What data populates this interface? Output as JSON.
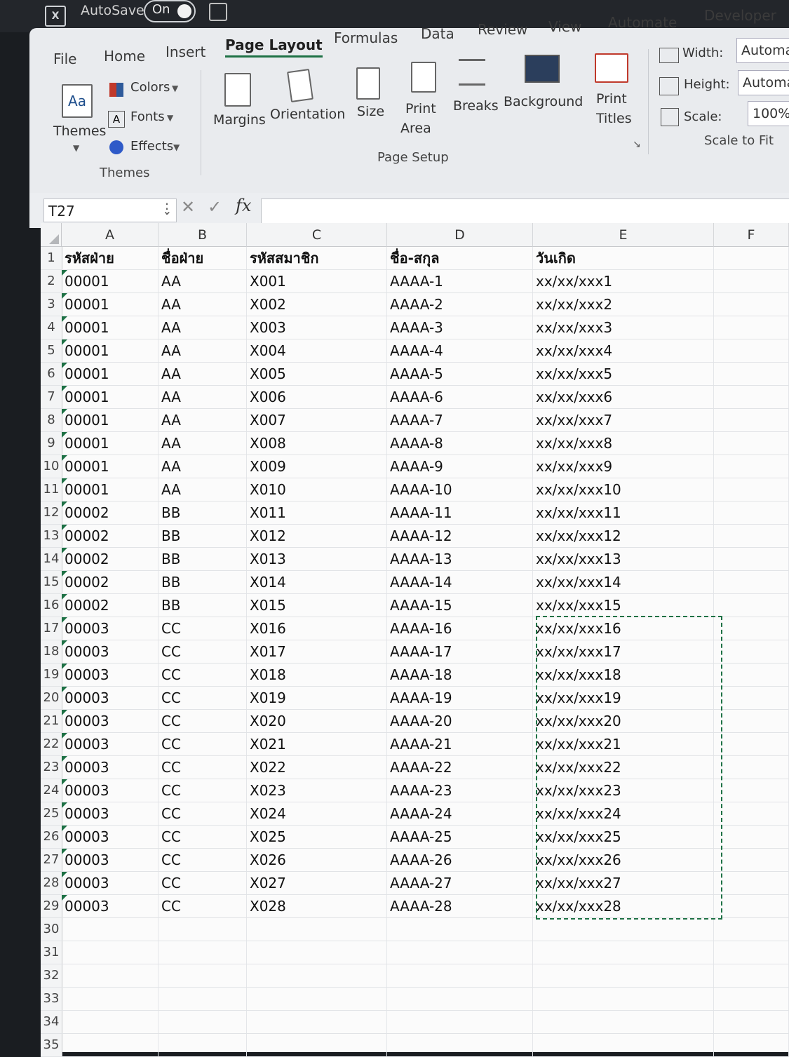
{
  "titlebar": {
    "app_icon": "excel-icon",
    "autosave_label": "AutoSave",
    "autosave_state": "On"
  },
  "ribbon": {
    "tabs": [
      "File",
      "Home",
      "Insert",
      "Page Layout",
      "Formulas",
      "Data",
      "Review",
      "View",
      "Automate",
      "Developer"
    ],
    "active_tab": "Page Layout",
    "themes_group": {
      "themes": "Themes",
      "colors": "Colors",
      "fonts": "Fonts",
      "effects": "Effects",
      "group_name": "Themes"
    },
    "page_setup_group": {
      "margins": "Margins",
      "orientation": "Orientation",
      "size": "Size",
      "print_area_1": "Print",
      "print_area_2": "Area",
      "breaks": "Breaks",
      "background": "Background",
      "print_titles_1": "Print",
      "print_titles_2": "Titles",
      "group_name": "Page Setup"
    },
    "scale_group": {
      "width_label": "Width:",
      "width_value": "Automatic",
      "height_label": "Height:",
      "height_value": "Automatic",
      "scale_label": "Scale:",
      "scale_value": "100%",
      "group_name": "Scale to Fit"
    }
  },
  "formula_bar": {
    "name_box": "T27",
    "cancel_icon": "cancel-icon",
    "enter_icon": "enter-icon",
    "fx_label": "fx",
    "formula": ""
  },
  "sheet": {
    "columns": [
      "A",
      "B",
      "C",
      "D",
      "E",
      "F"
    ],
    "headers": [
      "รหัสฝ่าย",
      "ชื่อฝ่าย",
      "รหัสสมาชิก",
      "ชื่อ-สกุล",
      "วันเกิด"
    ],
    "rows": [
      [
        "00001",
        "AA",
        "X001",
        "AAAA-1",
        "xx/xx/xxx1"
      ],
      [
        "00001",
        "AA",
        "X002",
        "AAAA-2",
        "xx/xx/xxx2"
      ],
      [
        "00001",
        "AA",
        "X003",
        "AAAA-3",
        "xx/xx/xxx3"
      ],
      [
        "00001",
        "AA",
        "X004",
        "AAAA-4",
        "xx/xx/xxx4"
      ],
      [
        "00001",
        "AA",
        "X005",
        "AAAA-5",
        "xx/xx/xxx5"
      ],
      [
        "00001",
        "AA",
        "X006",
        "AAAA-6",
        "xx/xx/xxx6"
      ],
      [
        "00001",
        "AA",
        "X007",
        "AAAA-7",
        "xx/xx/xxx7"
      ],
      [
        "00001",
        "AA",
        "X008",
        "AAAA-8",
        "xx/xx/xxx8"
      ],
      [
        "00001",
        "AA",
        "X009",
        "AAAA-9",
        "xx/xx/xxx9"
      ],
      [
        "00001",
        "AA",
        "X010",
        "AAAA-10",
        "xx/xx/xxx10"
      ],
      [
        "00002",
        "BB",
        "X011",
        "AAAA-11",
        "xx/xx/xxx11"
      ],
      [
        "00002",
        "BB",
        "X012",
        "AAAA-12",
        "xx/xx/xxx12"
      ],
      [
        "00002",
        "BB",
        "X013",
        "AAAA-13",
        "xx/xx/xxx13"
      ],
      [
        "00002",
        "BB",
        "X014",
        "AAAA-14",
        "xx/xx/xxx14"
      ],
      [
        "00002",
        "BB",
        "X015",
        "AAAA-15",
        "xx/xx/xxx15"
      ],
      [
        "00003",
        "CC",
        "X016",
        "AAAA-16",
        "xx/xx/xxx16"
      ],
      [
        "00003",
        "CC",
        "X017",
        "AAAA-17",
        "xx/xx/xxx17"
      ],
      [
        "00003",
        "CC",
        "X018",
        "AAAA-18",
        "xx/xx/xxx18"
      ],
      [
        "00003",
        "CC",
        "X019",
        "AAAA-19",
        "xx/xx/xxx19"
      ],
      [
        "00003",
        "CC",
        "X020",
        "AAAA-20",
        "xx/xx/xxx20"
      ],
      [
        "00003",
        "CC",
        "X021",
        "AAAA-21",
        "xx/xx/xxx21"
      ],
      [
        "00003",
        "CC",
        "X022",
        "AAAA-22",
        "xx/xx/xxx22"
      ],
      [
        "00003",
        "CC",
        "X023",
        "AAAA-23",
        "xx/xx/xxx23"
      ],
      [
        "00003",
        "CC",
        "X024",
        "AAAA-24",
        "xx/xx/xxx24"
      ],
      [
        "00003",
        "CC",
        "X025",
        "AAAA-25",
        "xx/xx/xxx25"
      ],
      [
        "00003",
        "CC",
        "X026",
        "AAAA-26",
        "xx/xx/xxx26"
      ],
      [
        "00003",
        "CC",
        "X027",
        "AAAA-27",
        "xx/xx/xxx27"
      ],
      [
        "00003",
        "CC",
        "X028",
        "AAAA-28",
        "xx/xx/xxx28"
      ]
    ],
    "empty_rows": [
      30,
      31,
      32,
      33,
      34,
      35
    ],
    "accent_color": "#1e7145"
  }
}
